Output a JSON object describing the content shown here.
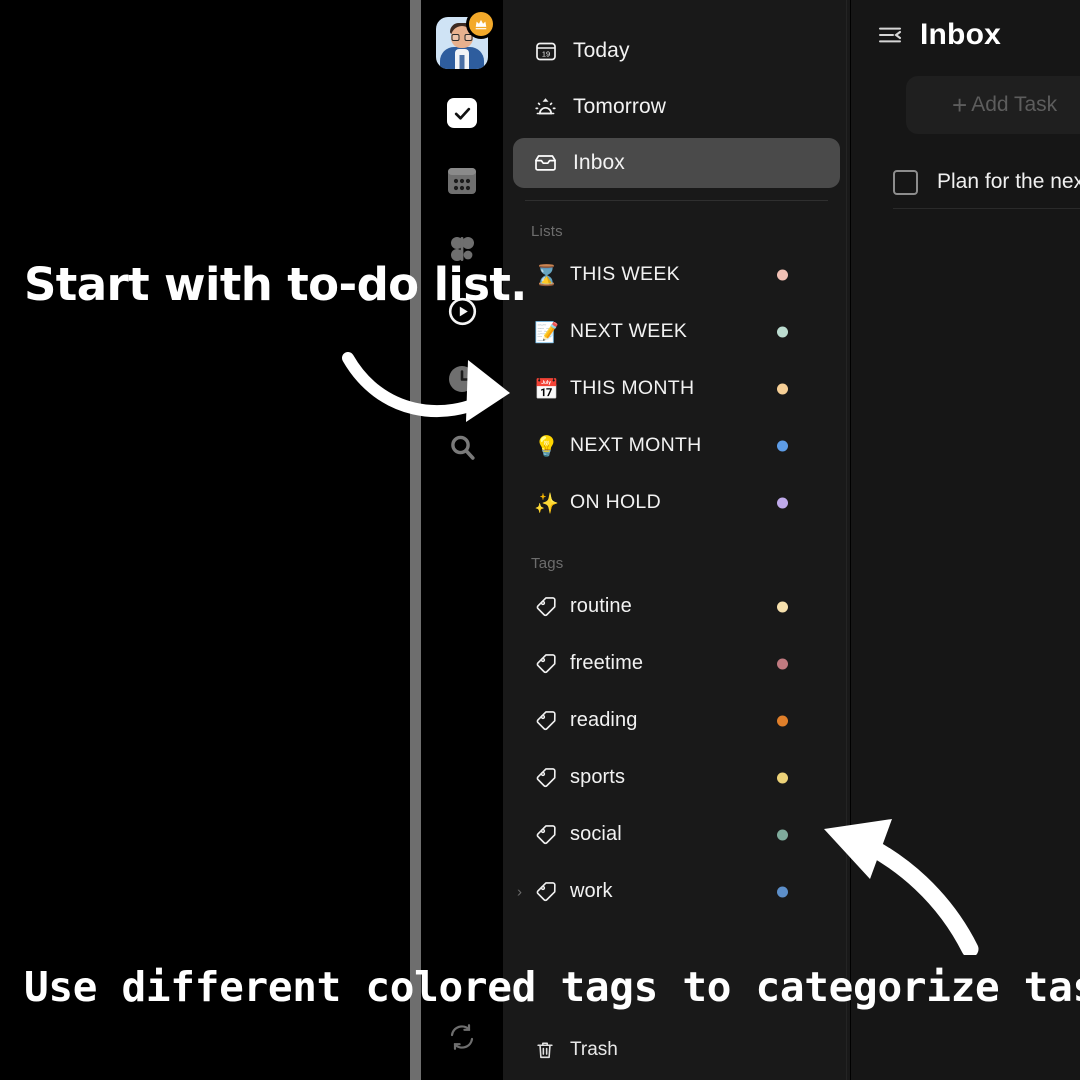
{
  "app": {
    "accent_selected_bg": "#4a4a4a",
    "panel_bg": "#191919",
    "main_bg": "#161616"
  },
  "rail": {
    "avatar": {
      "name": "user-avatar",
      "badge_icon": "crown-icon"
    },
    "items": [
      {
        "icon": "checkbox-check-icon",
        "name": "tasks",
        "active": true
      },
      {
        "icon": "habit-grid-icon",
        "name": "habits",
        "active": false
      },
      {
        "icon": "four-dot-clover-icon",
        "name": "countdown",
        "active": false
      },
      {
        "icon": "play-circle-icon",
        "name": "focus",
        "active": false
      },
      {
        "icon": "clock-icon",
        "name": "pomodoro",
        "active": false
      },
      {
        "icon": "search-icon",
        "name": "search",
        "active": false
      }
    ],
    "sync_icon": "sync-refresh-icon"
  },
  "sidebar": {
    "nav": [
      {
        "label": "Today",
        "icon": "calendar-19-icon",
        "selected": false
      },
      {
        "label": "Tomorrow",
        "icon": "sunrise-icon",
        "selected": false
      },
      {
        "label": "Inbox",
        "icon": "inbox-tray-icon",
        "selected": true
      }
    ],
    "lists_header": "Lists",
    "lists": [
      {
        "label": "THIS WEEK",
        "emoji": "⌛",
        "emoji_name": "hourglass-emoji",
        "dot": "#f0c0b4"
      },
      {
        "label": "NEXT WEEK",
        "emoji": "📝",
        "emoji_name": "memo-pencil-emoji",
        "dot": "#bcdcd0"
      },
      {
        "label": "THIS MONTH",
        "emoji": "📅",
        "emoji_name": "calendar-17-emoji",
        "dot": "#f6cf96"
      },
      {
        "label": "NEXT MONTH",
        "emoji": "💡",
        "emoji_name": "light-bulb-emoji",
        "dot": "#5d9ce6"
      },
      {
        "label": "ON HOLD",
        "emoji": "✨",
        "emoji_name": "sparkles-emoji",
        "dot": "#bfaaea"
      }
    ],
    "tags_header": "Tags",
    "tags": [
      {
        "label": "routine",
        "icon": "tag-icon",
        "dot": "#f6e0ad",
        "expandable": false
      },
      {
        "label": "freetime",
        "icon": "tag-icon",
        "dot": "#c07a80",
        "expandable": false
      },
      {
        "label": "reading",
        "icon": "tag-icon",
        "dot": "#e07f2a",
        "expandable": false
      },
      {
        "label": "sports",
        "icon": "tag-icon",
        "dot": "#ecd278",
        "expandable": false
      },
      {
        "label": "social",
        "icon": "tag-icon",
        "dot": "#7fab9c",
        "expandable": false
      },
      {
        "label": "work",
        "icon": "tag-icon",
        "dot": "#5d8fc9",
        "expandable": true,
        "chevron": "›"
      }
    ],
    "trash": {
      "label": "Trash",
      "icon": "trash-can-icon"
    }
  },
  "main": {
    "collapse_icon": "collapse-sidebar-icon",
    "title": "Inbox",
    "add_task": {
      "plus": "+",
      "label": "Add Task"
    },
    "tasks": [
      {
        "text": "Plan for the next",
        "checked": false
      }
    ]
  },
  "overlay": {
    "top_caption": "Start with to-do list.",
    "bottom_caption": "Use different colored tags to categorize tasks.",
    "arrow_top_name": "curved-arrow-right",
    "arrow_bottom_name": "curved-arrow-up-left"
  }
}
